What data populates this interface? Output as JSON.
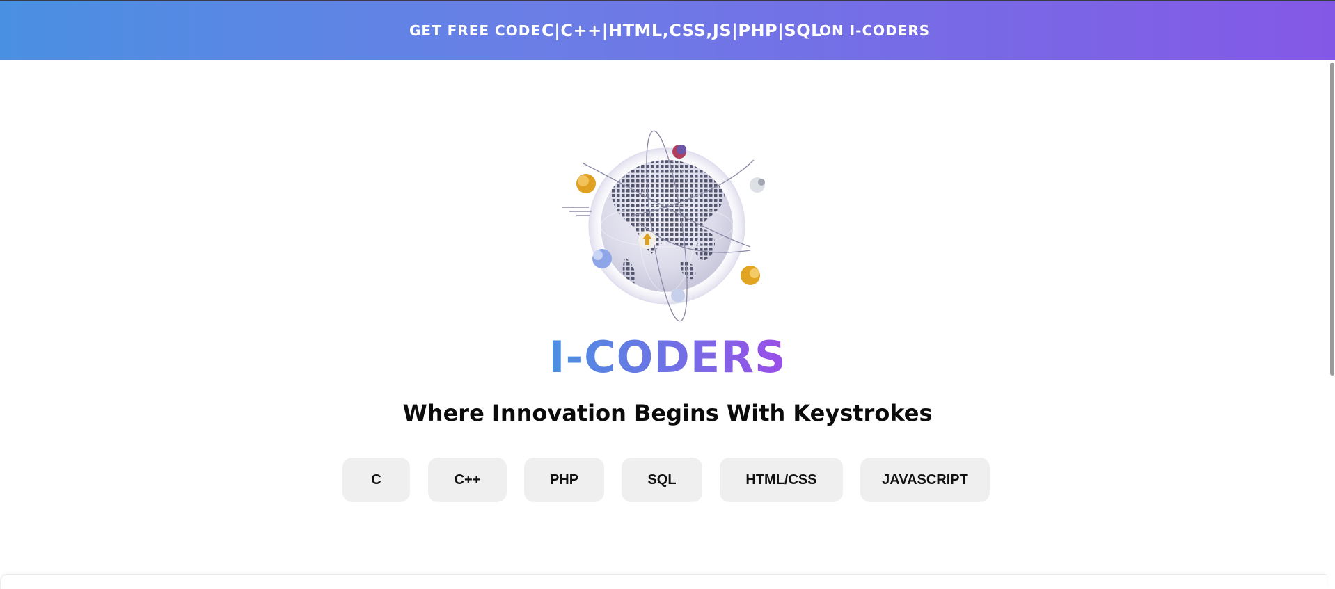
{
  "banner": {
    "left_text": "GET FREE CODE",
    "languages": "C|C++|HTML,CSS,JS|PHP|SQL",
    "right_text": "ON I-CODERS",
    "gradient_start": "#4a90e2",
    "gradient_end": "#8458e6"
  },
  "hero": {
    "globe_icon": "globe-icon",
    "brand": "I-CODERS",
    "tagline": "Where Innovation Begins With Keystrokes"
  },
  "languages": [
    {
      "label": "C"
    },
    {
      "label": "C++"
    },
    {
      "label": "PHP"
    },
    {
      "label": "SQL"
    },
    {
      "label": "HTML/CSS"
    },
    {
      "label": "JAVASCRIPT"
    }
  ],
  "colors": {
    "pill_bg": "#efefef",
    "brand_gradient_start": "#4a90e2",
    "brand_gradient_end": "#9b4ee8"
  }
}
